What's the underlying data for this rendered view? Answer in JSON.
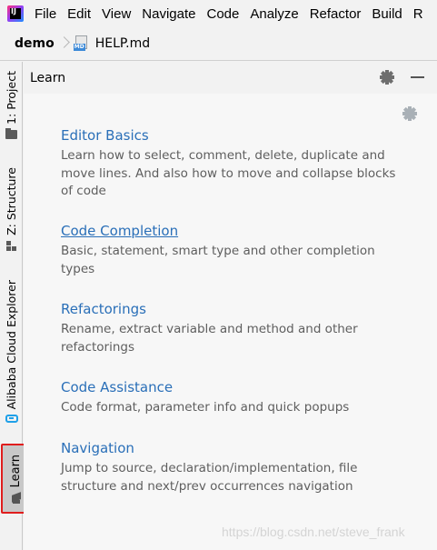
{
  "menubar": {
    "logo_icon": "intellij-logo-icon",
    "items": [
      "File",
      "Edit",
      "View",
      "Navigate",
      "Code",
      "Analyze",
      "Refactor",
      "Build",
      "R"
    ]
  },
  "breadcrumb": {
    "project": "demo",
    "file_badge": "MD",
    "file": "HELP.md"
  },
  "toolstrip": {
    "project_tab": "1: Project",
    "structure_tab": "Z: Structure",
    "cloud_tab": "Alibaba Cloud Explorer",
    "learn_tab": "Learn"
  },
  "panel": {
    "title": "Learn",
    "lessons": [
      {
        "title": "Editor Basics",
        "description": "Learn how to select, comment, delete, duplicate and move lines. And also how to move and collapse blocks of code"
      },
      {
        "title": "Code Completion",
        "description": "Basic, statement, smart type and other completion types"
      },
      {
        "title": "Refactorings",
        "description": "Rename, extract variable and method and other refactorings"
      },
      {
        "title": "Code Assistance",
        "description": "Code format, parameter info and quick popups"
      },
      {
        "title": "Navigation",
        "description": "Jump to source, declaration/implementation, file structure and next/prev occurrences navigation"
      }
    ]
  },
  "watermark": "https://blog.csdn.net/steve_frank",
  "colors": {
    "link": "#2a6fb8",
    "description": "#5e5e5e",
    "highlight_border": "#e01d1d",
    "cloud_icon": "#1fa0e8"
  }
}
